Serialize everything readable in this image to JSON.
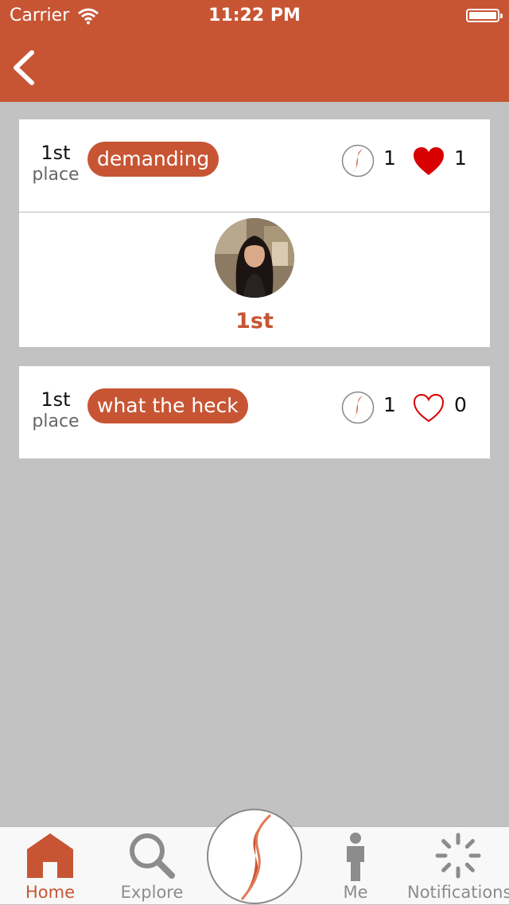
{
  "status_bar": {
    "carrier": "Carrier",
    "time": "11:22 PM"
  },
  "nav": {
    "back_icon": "chevron-left-icon"
  },
  "entries": [
    {
      "rank_number": "1st",
      "rank_word": "place",
      "tag": "demanding",
      "votes": "1",
      "likes": "1",
      "liked": true,
      "winner_rank": "1st"
    },
    {
      "rank_number": "1st",
      "rank_word": "place",
      "tag": "what the heck",
      "votes": "1",
      "likes": "0",
      "liked": false
    }
  ],
  "tabs": [
    {
      "label": "Home",
      "icon": "home-icon",
      "active": true
    },
    {
      "label": "Explore",
      "icon": "search-icon",
      "active": false
    },
    {
      "label": "",
      "icon": "app-logo-icon",
      "active": false
    },
    {
      "label": "Me",
      "icon": "person-icon",
      "active": false
    },
    {
      "label": "Notifications",
      "icon": "spinner-icon",
      "active": false
    }
  ],
  "colors": {
    "brand": "#c75534",
    "heart": "#d80000",
    "background": "#c2c2c2"
  }
}
